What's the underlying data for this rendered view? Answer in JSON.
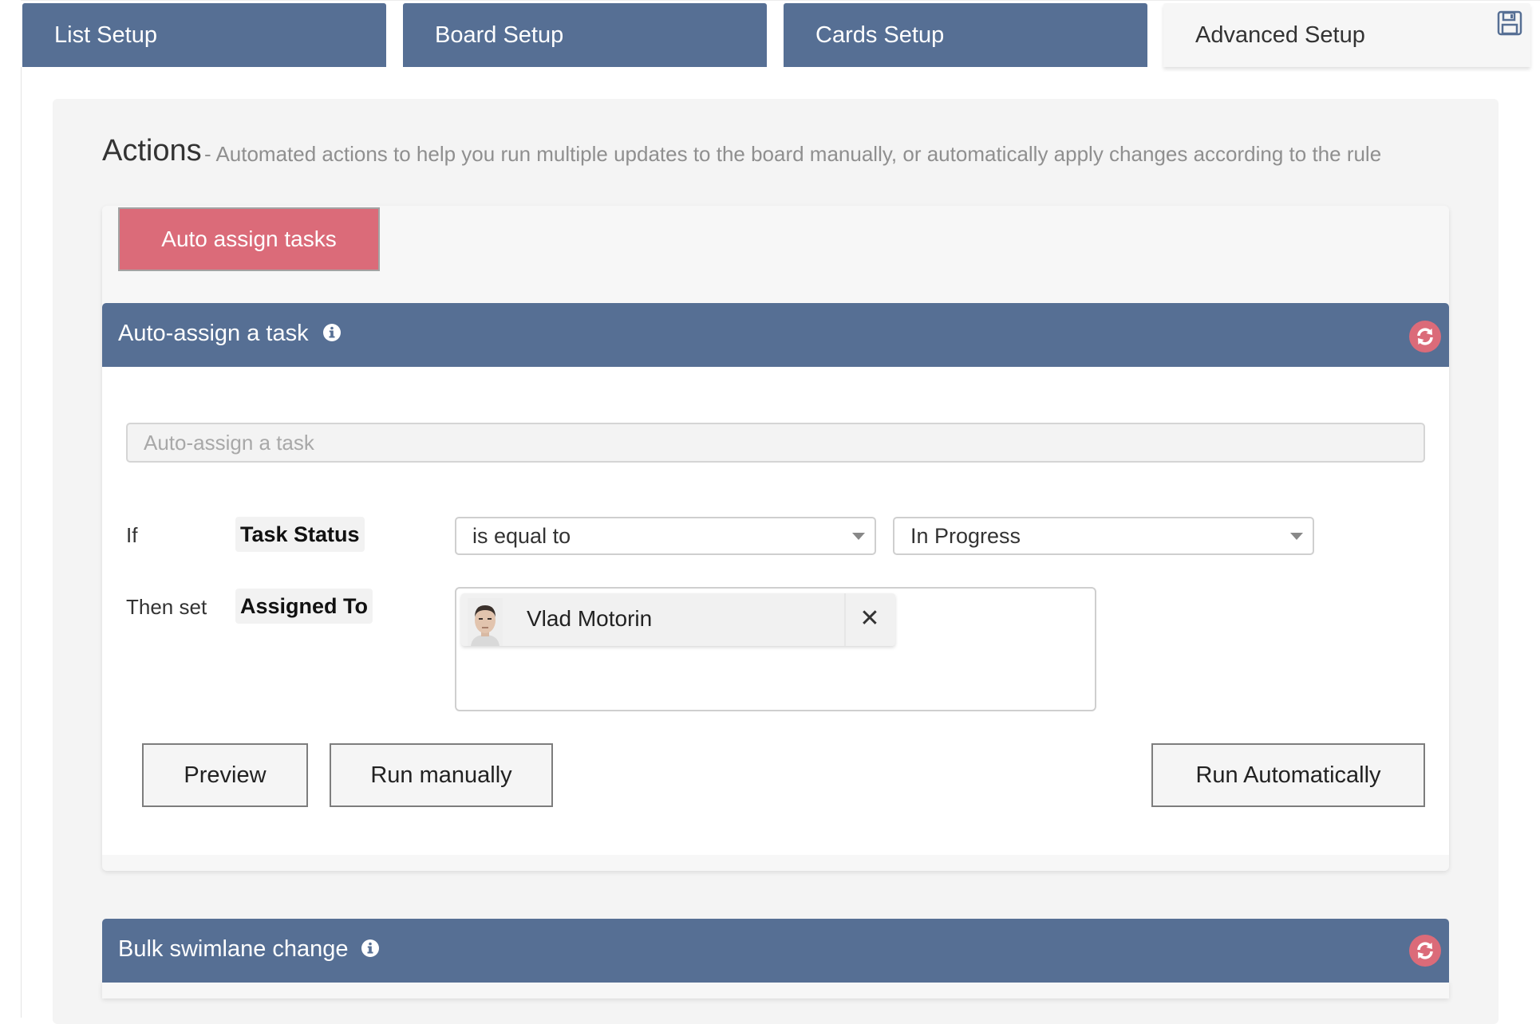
{
  "tabs": [
    {
      "label": "List Setup",
      "active": false
    },
    {
      "label": "Board Setup",
      "active": false
    },
    {
      "label": "Cards Setup",
      "active": false
    },
    {
      "label": "Advanced Setup",
      "active": true
    }
  ],
  "toolbar": {
    "save_icon": "save-icon"
  },
  "actions": {
    "title": "Actions",
    "description": "- Automated actions to help you run multiple updates to the board manually, or automatically apply changes according to the rule",
    "category_button": "Auto assign tasks"
  },
  "rule": {
    "header": "Auto-assign a task",
    "name_placeholder": "Auto-assign a task",
    "if_label": "If",
    "condition_field": "Task Status",
    "operator": "is equal to",
    "value": "In Progress",
    "then_label": "Then set",
    "target_field": "Assigned To",
    "assignee": "Vlad Motorin",
    "buttons": {
      "preview": "Preview",
      "run_manually": "Run manually",
      "run_automatically": "Run Automatically"
    }
  },
  "second_rule": {
    "header": "Bulk swimlane change"
  },
  "colors": {
    "header_blue": "#566f94",
    "accent_red": "#db6b79"
  }
}
